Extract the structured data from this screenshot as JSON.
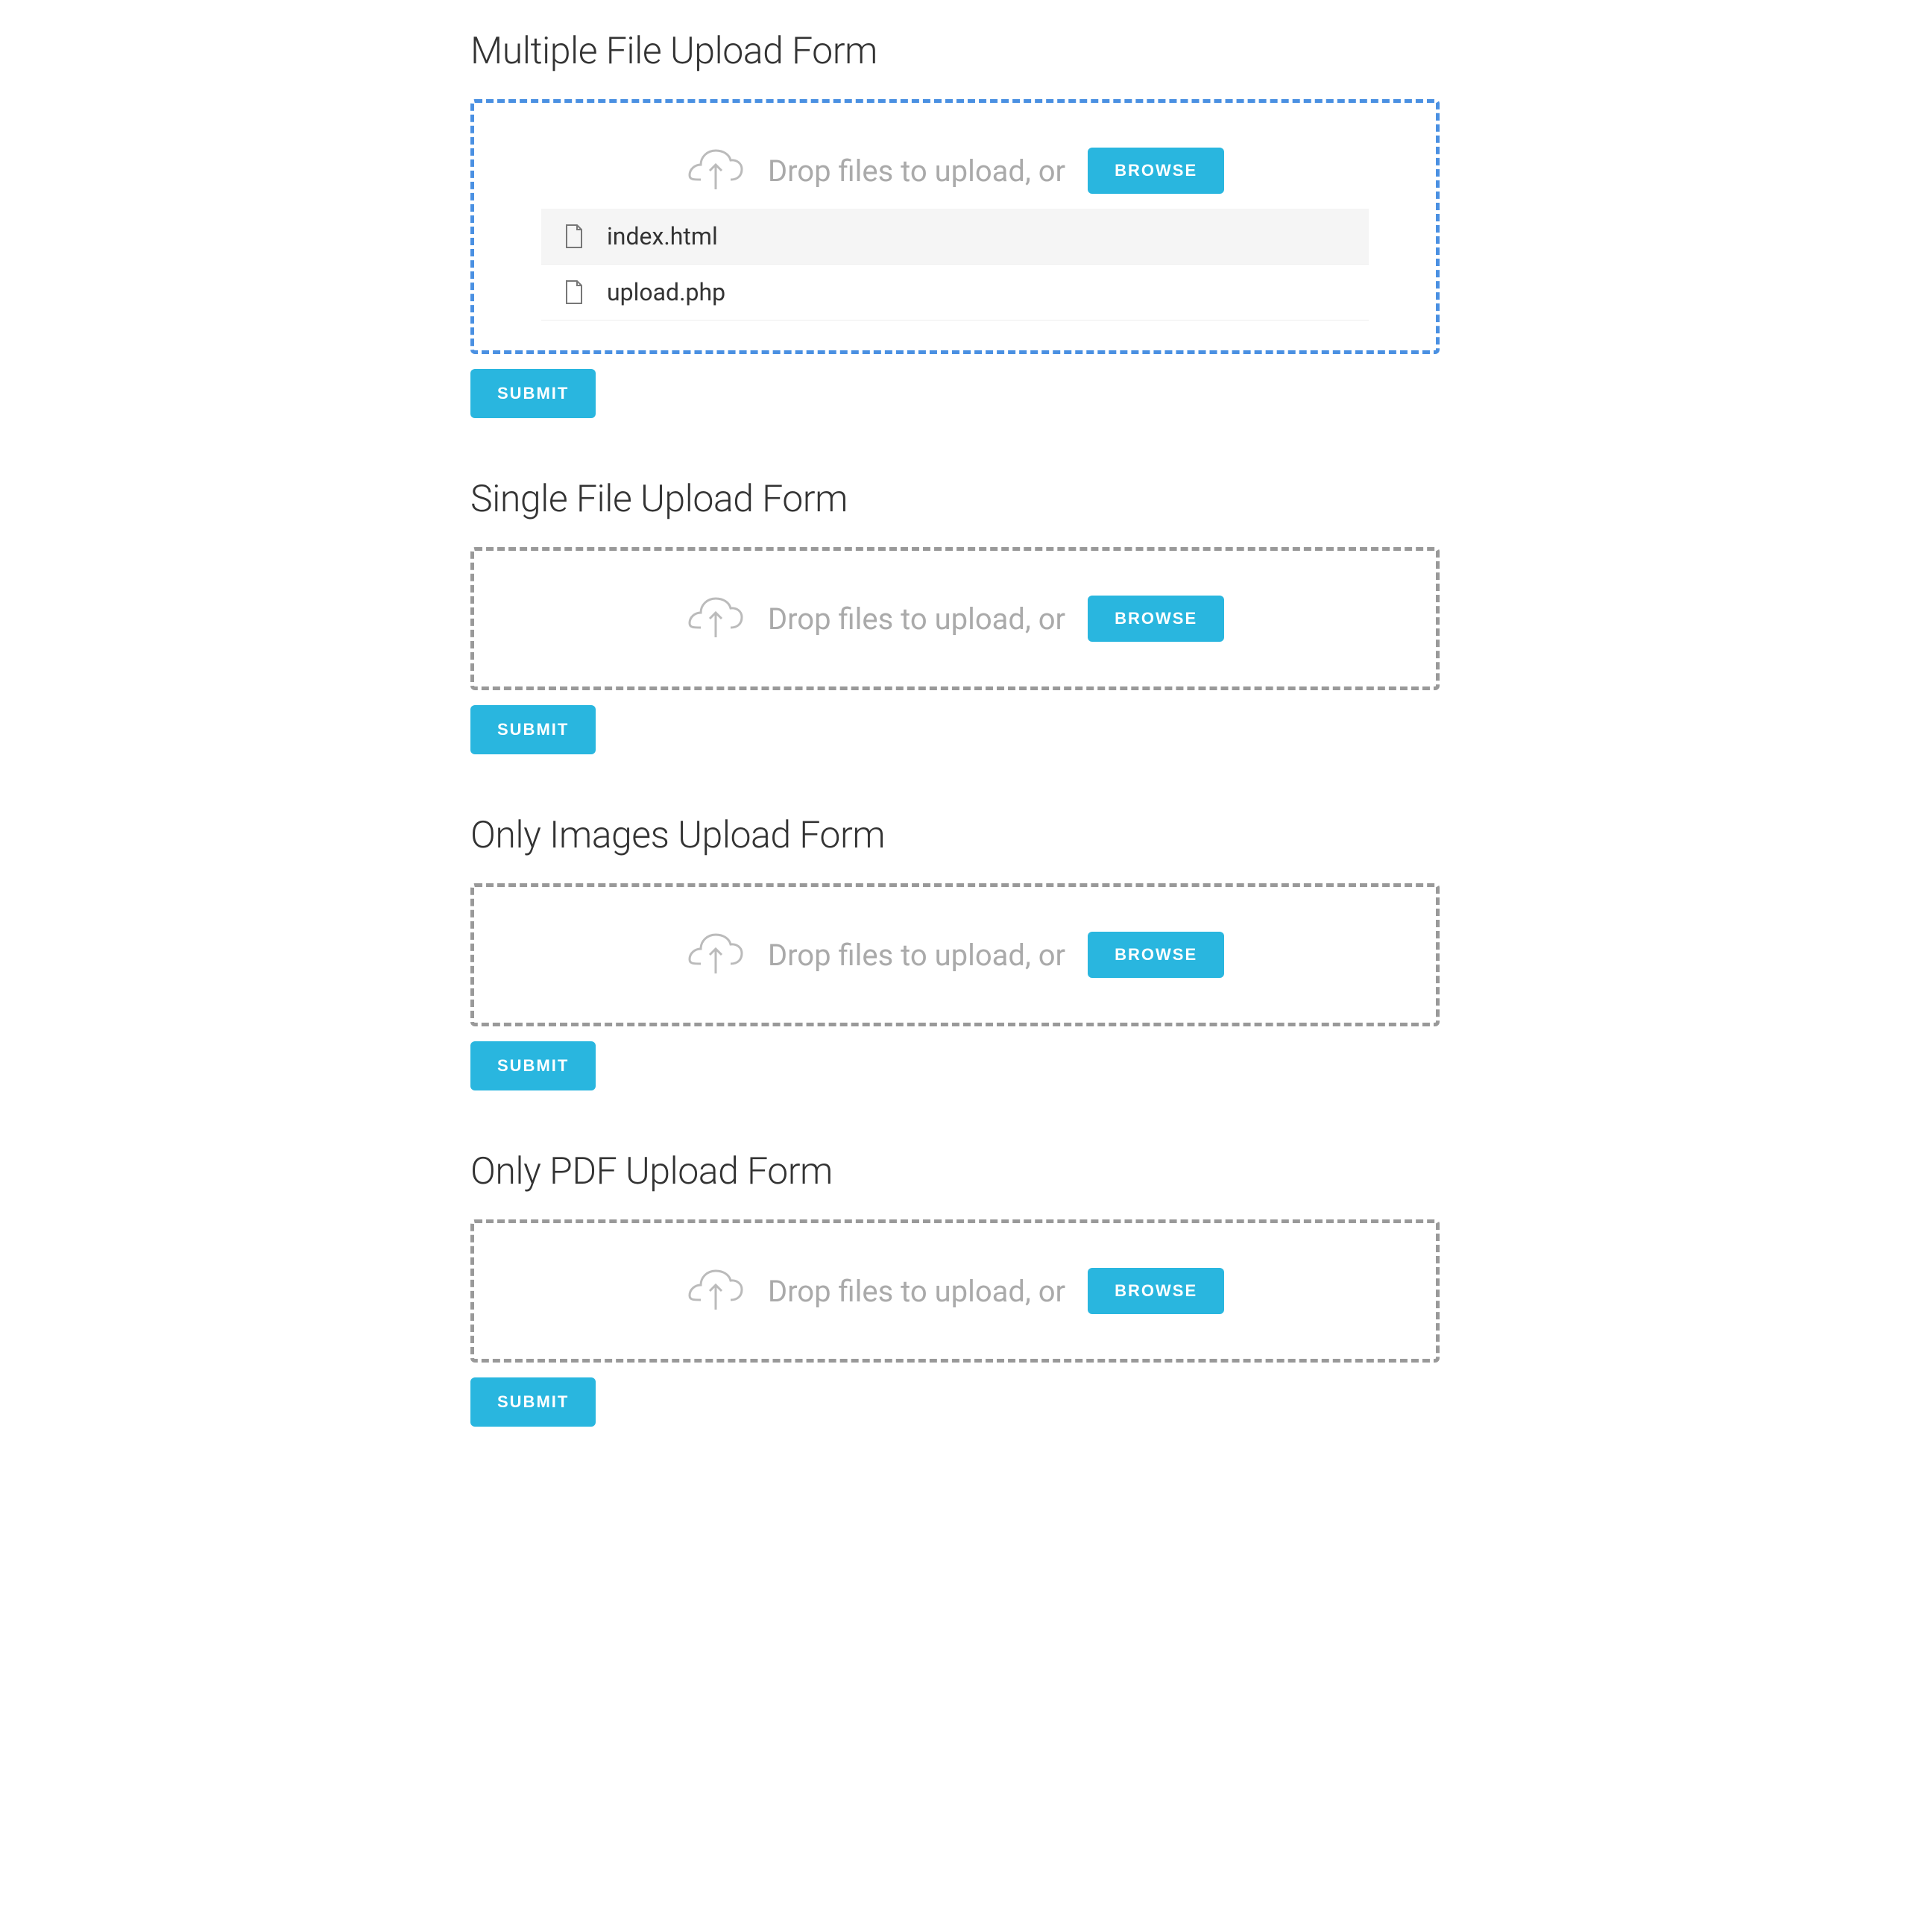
{
  "forms": [
    {
      "title": "Multiple File Upload Form",
      "drop_text": "Drop files to upload, or",
      "browse_label": "BROWSE",
      "submit_label": "SUBMIT",
      "active": true,
      "files": [
        {
          "name": "index.html"
        },
        {
          "name": "upload.php"
        }
      ]
    },
    {
      "title": "Single File Upload Form",
      "drop_text": "Drop files to upload, or",
      "browse_label": "BROWSE",
      "submit_label": "SUBMIT",
      "active": false,
      "files": []
    },
    {
      "title": "Only Images Upload Form",
      "drop_text": "Drop files to upload, or",
      "browse_label": "BROWSE",
      "submit_label": "SUBMIT",
      "active": false,
      "files": []
    },
    {
      "title": "Only PDF Upload Form",
      "drop_text": "Drop files to upload, or",
      "browse_label": "BROWSE",
      "submit_label": "SUBMIT",
      "active": false,
      "files": []
    }
  ]
}
